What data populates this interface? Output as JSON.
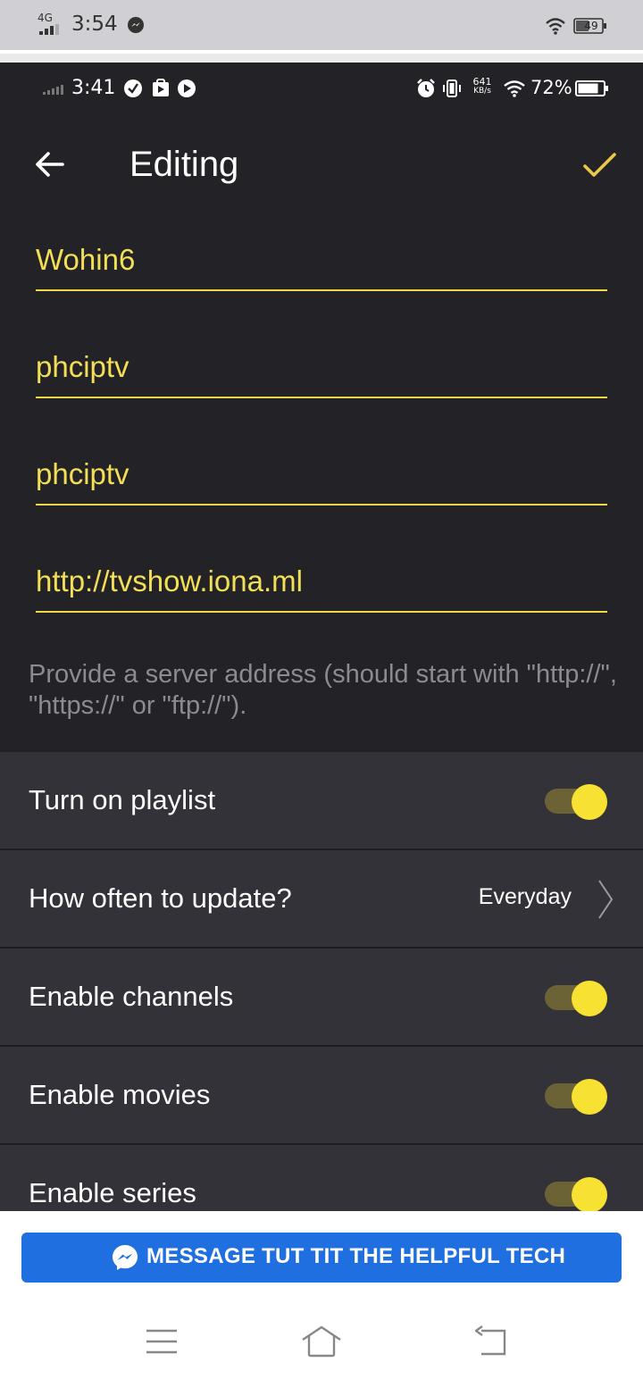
{
  "outer_status": {
    "network": "4G",
    "time": "3:54",
    "battery": "49",
    "messenger_icon": "messenger-icon",
    "wifi_icon": "wifi-icon"
  },
  "inner_status": {
    "time": "3:41",
    "icons_left": [
      "check-circle-icon",
      "play-store-icon",
      "play-icon"
    ],
    "icons_right": [
      "alarm-icon",
      "vibrate-icon"
    ],
    "speed_value": "641",
    "speed_unit": "KB/s",
    "battery_percent": "72%"
  },
  "toolbar": {
    "title": "Editing",
    "back_icon": "arrow-left-icon",
    "confirm_icon": "checkmark-icon"
  },
  "fields": [
    {
      "value": "Wohin6"
    },
    {
      "value": "phciptv"
    },
    {
      "value": "phciptv"
    },
    {
      "value": "http://tvshow.iona.ml"
    }
  ],
  "hint": "Provide a server address (should start with \"http://\", \"https://\" or \"ftp://\").",
  "settings": {
    "turn_on_playlist": {
      "label": "Turn on playlist",
      "enabled": true
    },
    "update_frequency": {
      "label": "How often to update?",
      "value": "Everyday"
    },
    "enable_channels": {
      "label": "Enable channels",
      "enabled": true
    },
    "enable_movies": {
      "label": "Enable movies",
      "enabled": true
    },
    "enable_series": {
      "label": "Enable series",
      "enabled": true
    }
  },
  "message_button": {
    "label": "MESSAGE TUT TIT THE HELPFUL TECH"
  },
  "colors": {
    "accent_yellow": "#f3df55",
    "background_dark": "#232327",
    "settings_bg": "#323238",
    "button_blue": "#1f6fe0"
  }
}
